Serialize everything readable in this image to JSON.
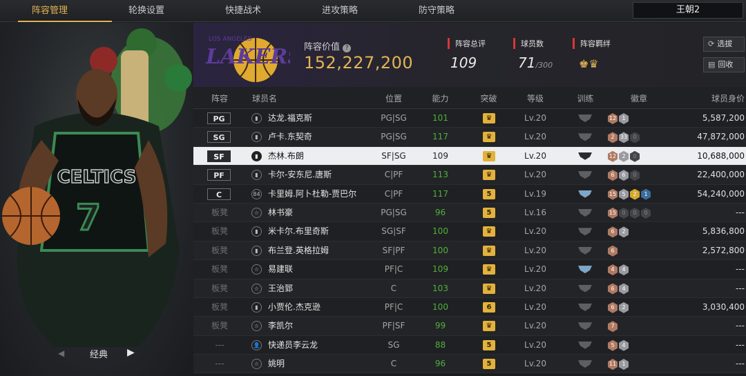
{
  "nav": {
    "tabs": [
      "阵容管理",
      "轮换设置",
      "快捷战术",
      "进攻策略",
      "防守策略"
    ],
    "active": 0,
    "dynasty": "王朝2"
  },
  "player_card": {
    "name": "经典",
    "jersey_text": "CELTICS",
    "jersey_number": "7"
  },
  "team": {
    "logo_text": "LAKERS",
    "logo_city": "LOS ANGELES",
    "lineup_value_label": "阵容价值",
    "lineup_value": "152,227,200",
    "stats": [
      {
        "label": "阵容总评",
        "value": "109",
        "sub": ""
      },
      {
        "label": "球员数",
        "value": "71",
        "sub": "/300"
      },
      {
        "label": "阵容羁绊",
        "value": "",
        "sub": ""
      }
    ],
    "buttons": {
      "select": "选拔",
      "recycle": "回收"
    }
  },
  "table": {
    "headers": [
      "阵容",
      "球员名",
      "位置",
      "能力",
      "突破",
      "等级",
      "训练",
      "徽章",
      "球员身价"
    ],
    "rows": [
      {
        "slot": "PG",
        "icon": "bars",
        "name": "达龙.福克斯",
        "pos": "PG|SG",
        "ability": "101",
        "break": "♛",
        "level": "Lv.20",
        "train": "gray",
        "badges": [
          [
            "b",
            "12"
          ],
          [
            "s",
            "1"
          ]
        ],
        "value": "5,587,200"
      },
      {
        "slot": "SG",
        "icon": "bars",
        "name": "卢卡.东契奇",
        "pos": "PG|SG",
        "ability": "117",
        "break": "♛",
        "level": "Lv.20",
        "train": "gray",
        "badges": [
          [
            "b",
            "2"
          ],
          [
            "s",
            "33"
          ],
          [
            "x",
            "0"
          ]
        ],
        "value": "47,872,000"
      },
      {
        "slot": "SF",
        "icon": "bars",
        "name": "杰林.布朗",
        "pos": "SF|SG",
        "ability": "109",
        "break": "♛",
        "level": "Lv.20",
        "train": "dark",
        "badges": [
          [
            "b",
            "12"
          ],
          [
            "s",
            "2"
          ],
          [
            "x",
            "0"
          ]
        ],
        "value": "10,688,000",
        "selected": true
      },
      {
        "slot": "PF",
        "icon": "bars",
        "name": "卡尔-安东尼.唐斯",
        "pos": "C|PF",
        "ability": "113",
        "break": "♛",
        "level": "Lv.20",
        "train": "gray",
        "badges": [
          [
            "b",
            "6"
          ],
          [
            "s",
            "6"
          ],
          [
            "x",
            "0"
          ]
        ],
        "value": "22,400,000"
      },
      {
        "slot": "C",
        "icon": "84",
        "name": "卡里姆.阿卜杜勒-贾巴尔",
        "pos": "C|PF",
        "ability": "117",
        "break": "5",
        "level": "Lv.19",
        "train": "blue",
        "badges": [
          [
            "b",
            "15"
          ],
          [
            "s",
            "5"
          ],
          [
            "g",
            "2"
          ],
          [
            "d",
            "1"
          ]
        ],
        "value": "54,240,000"
      },
      {
        "slot": "板凳",
        "icon": "star",
        "name": "林书豪",
        "pos": "PG|SG",
        "ability": "96",
        "break": "5",
        "level": "Lv.16",
        "train": "gray",
        "badges": [
          [
            "b",
            "15"
          ],
          [
            "x",
            "0"
          ],
          [
            "x",
            "0"
          ],
          [
            "x",
            "0"
          ]
        ],
        "value": "---"
      },
      {
        "slot": "板凳",
        "icon": "bars",
        "name": "米卡尔.布里奇斯",
        "pos": "SG|SF",
        "ability": "100",
        "break": "♛",
        "level": "Lv.20",
        "train": "gray",
        "badges": [
          [
            "b",
            "6"
          ],
          [
            "s",
            "2"
          ]
        ],
        "value": "5,836,800"
      },
      {
        "slot": "板凳",
        "icon": "bars",
        "name": "布兰登.英格拉姆",
        "pos": "SF|PF",
        "ability": "100",
        "break": "♛",
        "level": "Lv.20",
        "train": "gray",
        "badges": [
          [
            "b",
            "6"
          ]
        ],
        "value": "2,572,800"
      },
      {
        "slot": "板凳",
        "icon": "star",
        "name": "易建联",
        "pos": "PF|C",
        "ability": "109",
        "break": "♛",
        "level": "Lv.20",
        "train": "blue",
        "badges": [
          [
            "b",
            "4"
          ],
          [
            "s",
            "4"
          ]
        ],
        "value": "---"
      },
      {
        "slot": "板凳",
        "icon": "star",
        "name": "王治郅",
        "pos": "C",
        "ability": "103",
        "break": "♛",
        "level": "Lv.20",
        "train": "gray",
        "badges": [
          [
            "b",
            "6"
          ],
          [
            "s",
            "4"
          ]
        ],
        "value": "---"
      },
      {
        "slot": "板凳",
        "icon": "bars",
        "name": "小贾伦.杰克逊",
        "pos": "PF|C",
        "ability": "100",
        "break": "6",
        "level": "Lv.20",
        "train": "gray",
        "badges": [
          [
            "b",
            "6"
          ],
          [
            "s",
            "2"
          ]
        ],
        "value": "3,030,400"
      },
      {
        "slot": "板凳",
        "icon": "star",
        "name": "李凯尔",
        "pos": "PF|SF",
        "ability": "99",
        "break": "♛",
        "level": "Lv.20",
        "train": "gray",
        "badges": [
          [
            "b",
            "7"
          ]
        ],
        "value": "---"
      },
      {
        "slot": "---",
        "icon": "person",
        "name": "快递员李云龙",
        "pos": "SG",
        "ability": "88",
        "break": "5",
        "level": "Lv.20",
        "train": "gray",
        "badges": [
          [
            "b",
            "5"
          ],
          [
            "s",
            "4"
          ]
        ],
        "value": "---"
      },
      {
        "slot": "---",
        "icon": "star",
        "name": "姚明",
        "pos": "C",
        "ability": "96",
        "break": "5",
        "level": "Lv.20",
        "train": "gray",
        "badges": [
          [
            "b",
            "11"
          ],
          [
            "s",
            "1"
          ]
        ],
        "value": "---"
      }
    ]
  }
}
